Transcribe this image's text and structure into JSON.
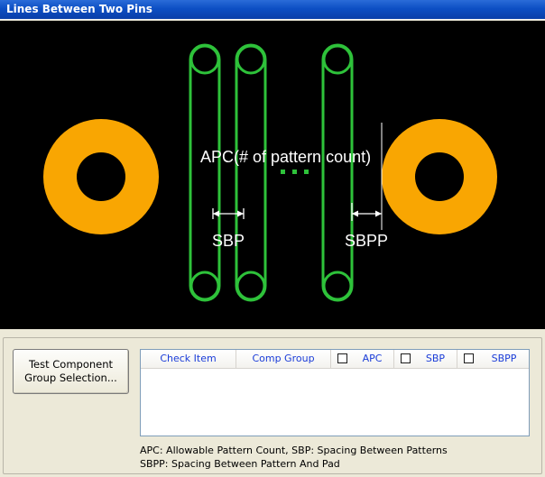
{
  "window": {
    "title": "Lines Between Two Pins"
  },
  "diagram": {
    "apc_label": "APC(# of pattern count)",
    "sbp_label": "SBP",
    "sbpp_label": "SBPP",
    "colors": {
      "pad": "#f9a602",
      "pattern": "#2ec23a",
      "background": "#000000",
      "text": "#ffffff"
    }
  },
  "panel": {
    "button_line1": "Test Component",
    "button_line2": "Group Selection...",
    "columns": {
      "check_item": "Check Item",
      "comp_group": "Comp Group",
      "apc": "APC",
      "sbp": "SBP",
      "sbpp": "SBPP"
    },
    "legend_line1": "APC: Allowable Pattern Count,  SBP: Spacing Between Patterns",
    "legend_line2": "SBPP: Spacing Between Pattern And Pad"
  }
}
